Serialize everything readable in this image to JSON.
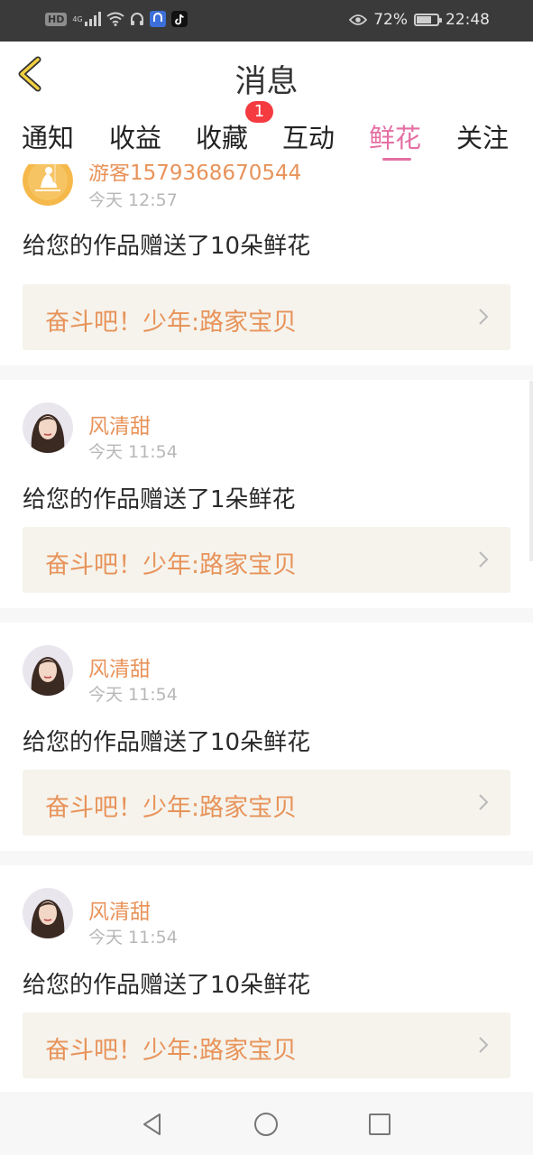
{
  "status_bar": {
    "hd": "HD",
    "net": "4G",
    "battery_pct": "72%",
    "battery_level": 0.72,
    "time": "22:48"
  },
  "header": {
    "title": "消息"
  },
  "tabs": [
    {
      "label": "通知",
      "active": false
    },
    {
      "label": "收益",
      "active": false
    },
    {
      "label": "收藏",
      "active": false,
      "badge": "1"
    },
    {
      "label": "互动",
      "active": false
    },
    {
      "label": "鲜花",
      "active": true
    },
    {
      "label": "关注",
      "active": false
    }
  ],
  "messages": [
    {
      "user": "游客1579368670544",
      "time": "今天 12:57",
      "text": "给您的作品赠送了10朵鲜花",
      "work": "奋斗吧！少年:路家宝贝",
      "avatar": "guest-avatar"
    },
    {
      "user": "风清甜",
      "time": "今天 11:54",
      "text": "给您的作品赠送了1朵鲜花",
      "work": "奋斗吧！少年:路家宝贝",
      "avatar": "user-photo-avatar"
    },
    {
      "user": "风清甜",
      "time": "今天 11:54",
      "text": "给您的作品赠送了10朵鲜花",
      "work": "奋斗吧！少年:路家宝贝",
      "avatar": "user-photo-avatar"
    },
    {
      "user": "风清甜",
      "time": "今天 11:54",
      "text": "给您的作品赠送了10朵鲜花",
      "work": "奋斗吧！少年:路家宝贝",
      "avatar": "user-photo-avatar"
    }
  ],
  "colors": {
    "accent": "#e56fa3",
    "name": "#e8935a",
    "badge": "#f43b40",
    "card_bg": "#f5f3ec"
  },
  "icons": [
    "back-chevron-icon",
    "eye-icon",
    "wifi-icon",
    "headphones-icon",
    "tiktok-icon",
    "chevron-right-icon",
    "nav-back-icon",
    "nav-home-icon",
    "nav-recents-icon"
  ]
}
